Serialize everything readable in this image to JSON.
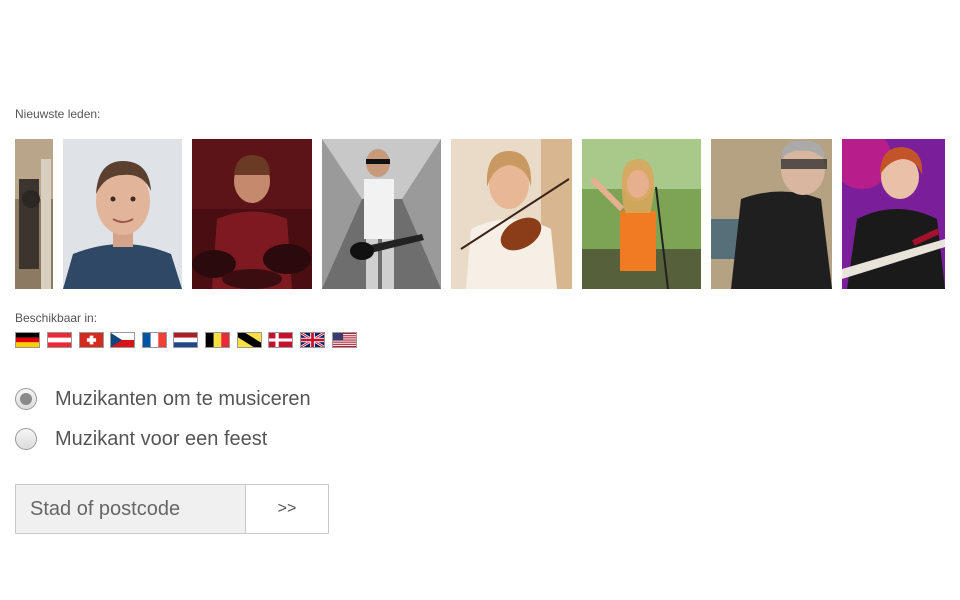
{
  "newest_members_label": "Nieuwste leden:",
  "members": [
    {
      "icon": "musician-photo-partial"
    },
    {
      "icon": "portrait-photo"
    },
    {
      "icon": "drummer-photo"
    },
    {
      "icon": "bassist-photo"
    },
    {
      "icon": "violinist-photo"
    },
    {
      "icon": "singer-photo"
    },
    {
      "icon": "guitarist-photo"
    },
    {
      "icon": "bass-player-photo"
    }
  ],
  "available_label": "Beschikbaar in:",
  "flags": [
    "de",
    "at",
    "ch",
    "cz",
    "fr",
    "nl",
    "be",
    "be-ge",
    "dk",
    "gb",
    "us"
  ],
  "options": {
    "musicians_label": "Muzikanten om te musiceren",
    "party_label": "Muzikant voor een feest",
    "selected": "musicians"
  },
  "search": {
    "placeholder": "Stad of postcode",
    "submit_label": ">>"
  }
}
